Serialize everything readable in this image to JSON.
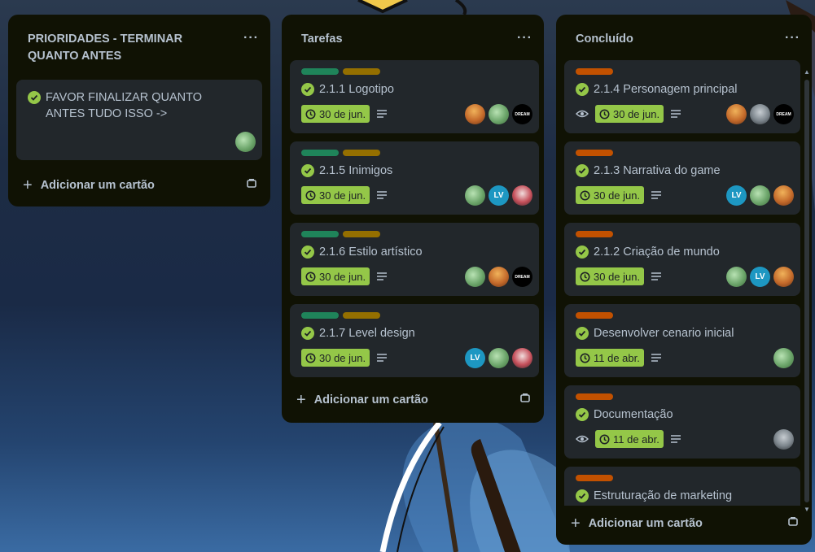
{
  "board": {
    "lists": [
      {
        "title": "PRIORIDADES - TERMINAR QUANTO ANTES",
        "menu_icon": "···",
        "add_card_label": "Adicionar um cartão",
        "cards": [
          {
            "title": "FAVOR FINALIZAR QUANTO ANTES TUDO ISSO ->",
            "completed": true
          }
        ]
      },
      {
        "title": "Tarefas",
        "menu_icon": "···",
        "add_card_label": "Adicionar um cartão",
        "cards": [
          {
            "title": "2.1.1 Logotipo",
            "due": "30 de jun.",
            "labels": [
              "green",
              "yellow"
            ],
            "members": [
              "orange-avatar",
              "green-avatar",
              "dream-avatar"
            ]
          },
          {
            "title": "2.1.5 Inimigos",
            "due": "30 de jun.",
            "labels": [
              "green",
              "yellow"
            ],
            "members": [
              "green-avatar",
              "LV",
              "red-avatar"
            ]
          },
          {
            "title": "2.1.6 Estilo artístico",
            "due": "30 de jun.",
            "labels": [
              "green",
              "yellow"
            ],
            "members": [
              "green-avatar",
              "orange-avatar",
              "dream-avatar"
            ]
          },
          {
            "title": "2.1.7 Level design",
            "due": "30 de jun.",
            "labels": [
              "green",
              "yellow"
            ],
            "members": [
              "LV",
              "green-avatar",
              "red-avatar"
            ]
          }
        ]
      },
      {
        "title": "Concluído",
        "menu_icon": "···",
        "add_card_label": "Adicionar um cartão",
        "cards": [
          {
            "title": "2.1.4 Personagem principal",
            "due": "30 de jun.",
            "watching": true,
            "labels": [
              "orange"
            ],
            "members": [
              "orange-avatar",
              "gray-avatar",
              "dream-avatar"
            ]
          },
          {
            "title": "2.1.3 Narrativa do game",
            "due": "30 de jun.",
            "labels": [
              "orange"
            ],
            "members": [
              "LV",
              "green-avatar",
              "orange-avatar"
            ]
          },
          {
            "title": "2.1.2 Criação de mundo",
            "due": "30 de jun.",
            "labels": [
              "orange"
            ],
            "members": [
              "green-avatar",
              "LV",
              "orange-avatar"
            ]
          },
          {
            "title": "Desenvolver cenario inicial",
            "due": "11 de abr.",
            "labels": [
              "orange"
            ],
            "members": [
              "green-avatar"
            ]
          },
          {
            "title": "Documentação",
            "due": "11 de abr.",
            "watching": true,
            "labels": [
              "orange"
            ],
            "members": [
              "gray-avatar"
            ]
          },
          {
            "title": "Estruturação de marketing",
            "labels": [
              "orange"
            ]
          }
        ]
      }
    ],
    "member_initials": {
      "lv": "LV"
    },
    "dream_text": "DREAM"
  },
  "colors": {
    "list_bg": "#101204",
    "card_bg": "#22272b",
    "due_complete": "#94c748",
    "label_green": "#1f845a",
    "label_yellow": "#946f00",
    "label_orange": "#c25100",
    "avatar_lv": "#1d97c2"
  }
}
